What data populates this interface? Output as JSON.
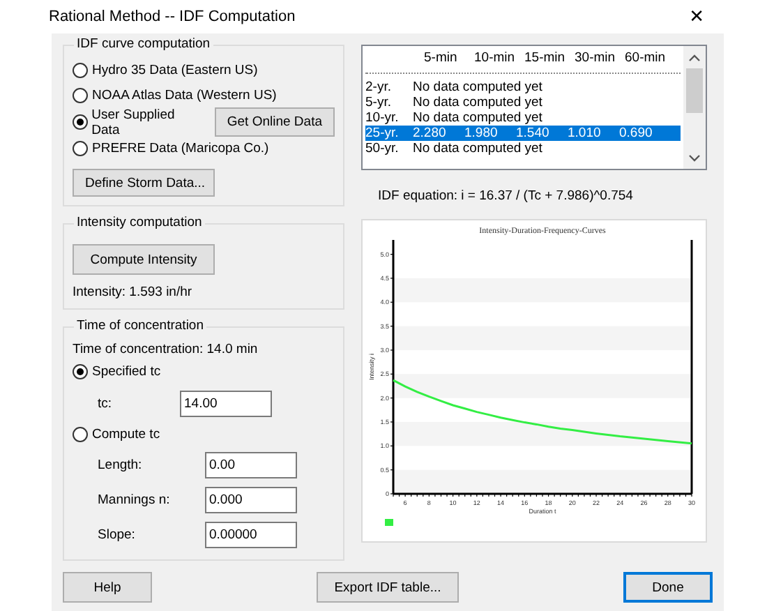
{
  "window": {
    "title": "Rational Method -- IDF Computation",
    "close": "✕"
  },
  "idf_curve": {
    "title": "IDF curve computation",
    "options": [
      {
        "label": "Hydro 35 Data (Eastern US)",
        "selected": false
      },
      {
        "label": "NOAA Atlas Data (Western US)",
        "selected": false
      },
      {
        "label": "User Supplied Data",
        "selected": true
      },
      {
        "label": "PREFRE Data (Maricopa Co.)",
        "selected": false
      }
    ],
    "online_button": "Get Online Data",
    "define_button": "Define Storm Data..."
  },
  "intensity": {
    "title": "Intensity computation",
    "button": "Compute Intensity",
    "result": "Intensity:  1.593 in/hr"
  },
  "time_of_concentration": {
    "title": "Time of concentration",
    "summary": "Time of concentration:  14.0 min",
    "specified": {
      "label": "Specified tc",
      "selected": true
    },
    "tc_field": {
      "label": "tc:",
      "value": "14.00"
    },
    "compute": {
      "label": "Compute tc",
      "selected": false
    },
    "fields": [
      {
        "label": "Length:",
        "value": "0.00"
      },
      {
        "label": "Mannings n:",
        "value": "0.000"
      },
      {
        "label": "Slope:",
        "value": "0.00000"
      }
    ]
  },
  "idf_table": {
    "columns": [
      "5-min",
      "10-min",
      "15-min",
      "30-min",
      "60-min"
    ],
    "rows": [
      {
        "label": "2-yr.",
        "note": "No data computed yet",
        "selected": false
      },
      {
        "label": "5-yr.",
        "note": "No data computed yet",
        "selected": false
      },
      {
        "label": "10-yr.",
        "note": "No data computed yet",
        "selected": false
      },
      {
        "label": "25-yr.",
        "values": [
          "2.280",
          "1.980",
          "1.540",
          "1.010",
          "0.690"
        ],
        "selected": true
      },
      {
        "label": "50-yr.",
        "note": "No data computed yet",
        "selected": false
      }
    ]
  },
  "equation": "IDF equation: i = 16.37 / (Tc + 7.986)^0.754",
  "chart": {
    "chart_data": {
      "type": "line",
      "title": "Intensity-Duration-Frequency-Curves",
      "xlabel": "Duration t",
      "ylabel": "Intensity i",
      "x": [
        5,
        6,
        7,
        8,
        9,
        10,
        11,
        12,
        13,
        14,
        15,
        16,
        17,
        18,
        19,
        20,
        22,
        24,
        26,
        28,
        30
      ],
      "series": [
        {
          "color": "#33ee44",
          "values": [
            2.37,
            2.24,
            2.13,
            2.03,
            1.94,
            1.85,
            1.78,
            1.71,
            1.65,
            1.59,
            1.54,
            1.49,
            1.45,
            1.4,
            1.36,
            1.33,
            1.26,
            1.2,
            1.15,
            1.1,
            1.05
          ]
        }
      ],
      "xlim": [
        5,
        30
      ],
      "ylim": [
        0,
        5.3
      ],
      "xticks": [
        6,
        8,
        10,
        12,
        14,
        16,
        18,
        20,
        22,
        24,
        26,
        28,
        30
      ],
      "yticks": [
        0,
        {
          "value": 0.5,
          "label": "0.5"
        },
        {
          "value": 1,
          "label": "1.0"
        },
        {
          "value": 1.5,
          "label": "1.5"
        },
        {
          "value": 2,
          "label": "2.0"
        },
        {
          "value": 2.5,
          "label": "2.5"
        },
        {
          "value": 3,
          "label": "3.0"
        },
        {
          "value": 3.5,
          "label": "3.5"
        },
        {
          "value": 4,
          "label": "4.0"
        },
        {
          "value": 4.5,
          "label": "4.5"
        },
        {
          "value": 5,
          "label": "5.0"
        }
      ]
    }
  },
  "footer_buttons": [
    {
      "label": "Help",
      "default": false
    },
    {
      "label": "Export IDF table...",
      "default": false
    },
    {
      "label": "Done",
      "default": true
    }
  ]
}
